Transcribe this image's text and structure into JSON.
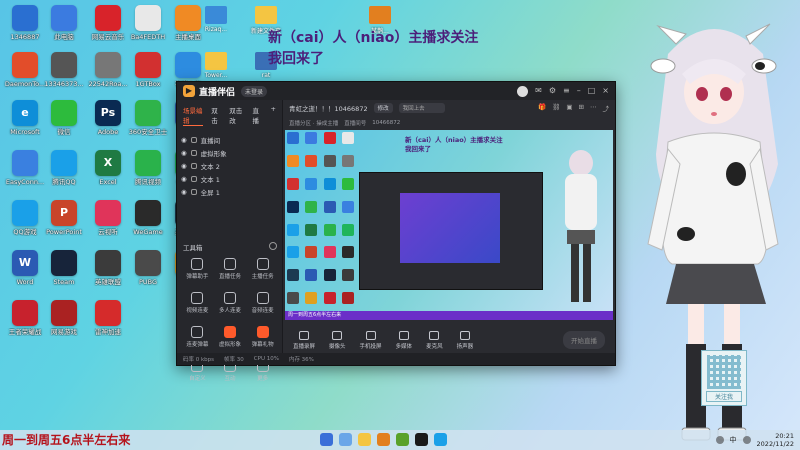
{
  "desktop": {
    "icons": [
      {
        "label": "1346887\n2",
        "color": "#2a6fd1",
        "glyph": ""
      },
      {
        "label": "此电脑\nBAT",
        "color": "#3b7be0",
        "glyph": ""
      },
      {
        "label": "网易云音乐",
        "color": "#d8232a",
        "glyph": ""
      },
      {
        "label": "Ba4FEDTH",
        "color": "#e8e8e8",
        "glyph": ""
      },
      {
        "label": "主播桌面",
        "color": "#f08a24",
        "glyph": ""
      },
      {
        "label": "DaemonTo...",
        "color": "#e24d2a",
        "glyph": ""
      },
      {
        "label": "13346373...",
        "color": "#555",
        "glyph": ""
      },
      {
        "label": "22542Roa...",
        "color": "#777",
        "glyph": ""
      },
      {
        "label": "1GTBox",
        "color": "#d23030",
        "glyph": ""
      },
      {
        "label": "有道上海",
        "color": "#2d8ce0",
        "glyph": ""
      },
      {
        "label": "Microsoft\nEdge",
        "color": "#0e8ed8",
        "glyph": "e"
      },
      {
        "label": "微信",
        "color": "#2dbb3d",
        "glyph": ""
      },
      {
        "label": "Adobe\nPhotosh...",
        "color": "#0a2a52",
        "glyph": "Ps"
      },
      {
        "label": "360安全卫士",
        "color": "#2fb34a",
        "glyph": ""
      },
      {
        "label": "Word",
        "color": "#2b5ab3",
        "glyph": "W"
      },
      {
        "label": "EasyConn...",
        "color": "#3a80e0",
        "glyph": ""
      },
      {
        "label": "腾讯QQ",
        "color": "#1aa0e8",
        "glyph": ""
      },
      {
        "label": "Excel",
        "color": "#1f7a43",
        "glyph": "X"
      },
      {
        "label": "腾讯视频",
        "color": "#2ab24b",
        "glyph": ""
      },
      {
        "label": "QQ音乐",
        "color": "#1fb55a",
        "glyph": ""
      },
      {
        "label": "QQ游戏",
        "color": "#1aa0e8",
        "glyph": ""
      },
      {
        "label": "PowerPoint",
        "color": "#c9442a",
        "glyph": "P"
      },
      {
        "label": "云视听",
        "color": "#e0345a",
        "glyph": ""
      },
      {
        "label": "WeGame",
        "color": "#2a2a2a",
        "glyph": ""
      },
      {
        "label": "英雄联盟",
        "color": "#1c3a52",
        "glyph": ""
      },
      {
        "label": "Word",
        "color": "#2b5ab3",
        "glyph": "W"
      },
      {
        "label": "Steam",
        "color": "#17243a",
        "glyph": ""
      },
      {
        "label": "英雄联盟\nWeGame...",
        "color": "#3b3b3b",
        "glyph": ""
      },
      {
        "label": "PUBG\nBATTLE...",
        "color": "#4a4a4a",
        "glyph": ""
      },
      {
        "label": "学英语",
        "color": "#e0a020",
        "glyph": ""
      },
      {
        "label": "王者荣耀战",
        "color": "#c7222d",
        "glyph": ""
      },
      {
        "label": "网易游戏",
        "color": "#aa2222",
        "glyph": ""
      },
      {
        "label": "雷神加速",
        "color": "#d52b2b",
        "glyph": ""
      }
    ],
    "files": [
      {
        "label": "Rizaq...",
        "color": "#3a8ad8"
      },
      {
        "label": "新建文件夹",
        "color": "#f4c542"
      },
      {
        "label": "Tower...",
        "color": "#f4c542"
      },
      {
        "label": "rat",
        "color": "#3a6fb6"
      },
      {
        "label": "某鹊...",
        "color": "#e27f1f"
      }
    ]
  },
  "overlay_message": {
    "line1": "新（cai）人（niao）主播求关注",
    "line2": "我回来了"
  },
  "app": {
    "name": "直播伴侣",
    "badge": "未登录",
    "scene_tabs": [
      "场景编辑",
      "双击",
      "双击改",
      "直播"
    ],
    "sources": [
      "直播间",
      "虚拟形象",
      "文本 2",
      "文本 1",
      "全屏 1"
    ],
    "tools_title": "工具箱",
    "tools": [
      {
        "label": "弹幕助手",
        "hot": false
      },
      {
        "label": "直播任务",
        "hot": false
      },
      {
        "label": "主播任务",
        "hot": false
      },
      {
        "label": "视频连麦",
        "hot": false
      },
      {
        "label": "多人连麦",
        "hot": false
      },
      {
        "label": "音频连麦",
        "hot": false
      },
      {
        "label": "连麦弹幕",
        "hot": false
      },
      {
        "label": "虚拟形象",
        "hot": true
      },
      {
        "label": "弹幕礼物",
        "hot": true
      },
      {
        "label": "自定义",
        "hot": false
      },
      {
        "label": "互动",
        "hot": false
      },
      {
        "label": "更多",
        "hot": false
      }
    ],
    "room_title": "青虹之逝！！！10466872",
    "room_edit": "修改",
    "room_input": "我回上去",
    "room_sub": [
      "直播分区 · 操成主播",
      "直播间号",
      "10466872"
    ],
    "controls": [
      "直播录屏",
      "摄像头",
      "手机投屏",
      "多媒体",
      "麦克风",
      "扬声器"
    ],
    "start_button": "开始直播",
    "status": [
      "码率 0 kbps",
      "帧率 30",
      "CPU 10%",
      "内存 36%"
    ],
    "preview_msg1": "新（cai）人（niao）主播求关注",
    "preview_msg2": "我回来了",
    "preview_bottom": "周一到周五6点半左右来"
  },
  "qr_follow": "关注我",
  "schedule_text": "周一到周五6点半左右来",
  "taskbar": {
    "apps": [
      "#3a6fd8",
      "#6aa6e8",
      "#f4c542",
      "#e27f1f",
      "#5aa12a",
      "#1a1a1a",
      "#1aa0e8"
    ],
    "ime": "中",
    "time": "20:21",
    "date": "2022/11/22"
  }
}
